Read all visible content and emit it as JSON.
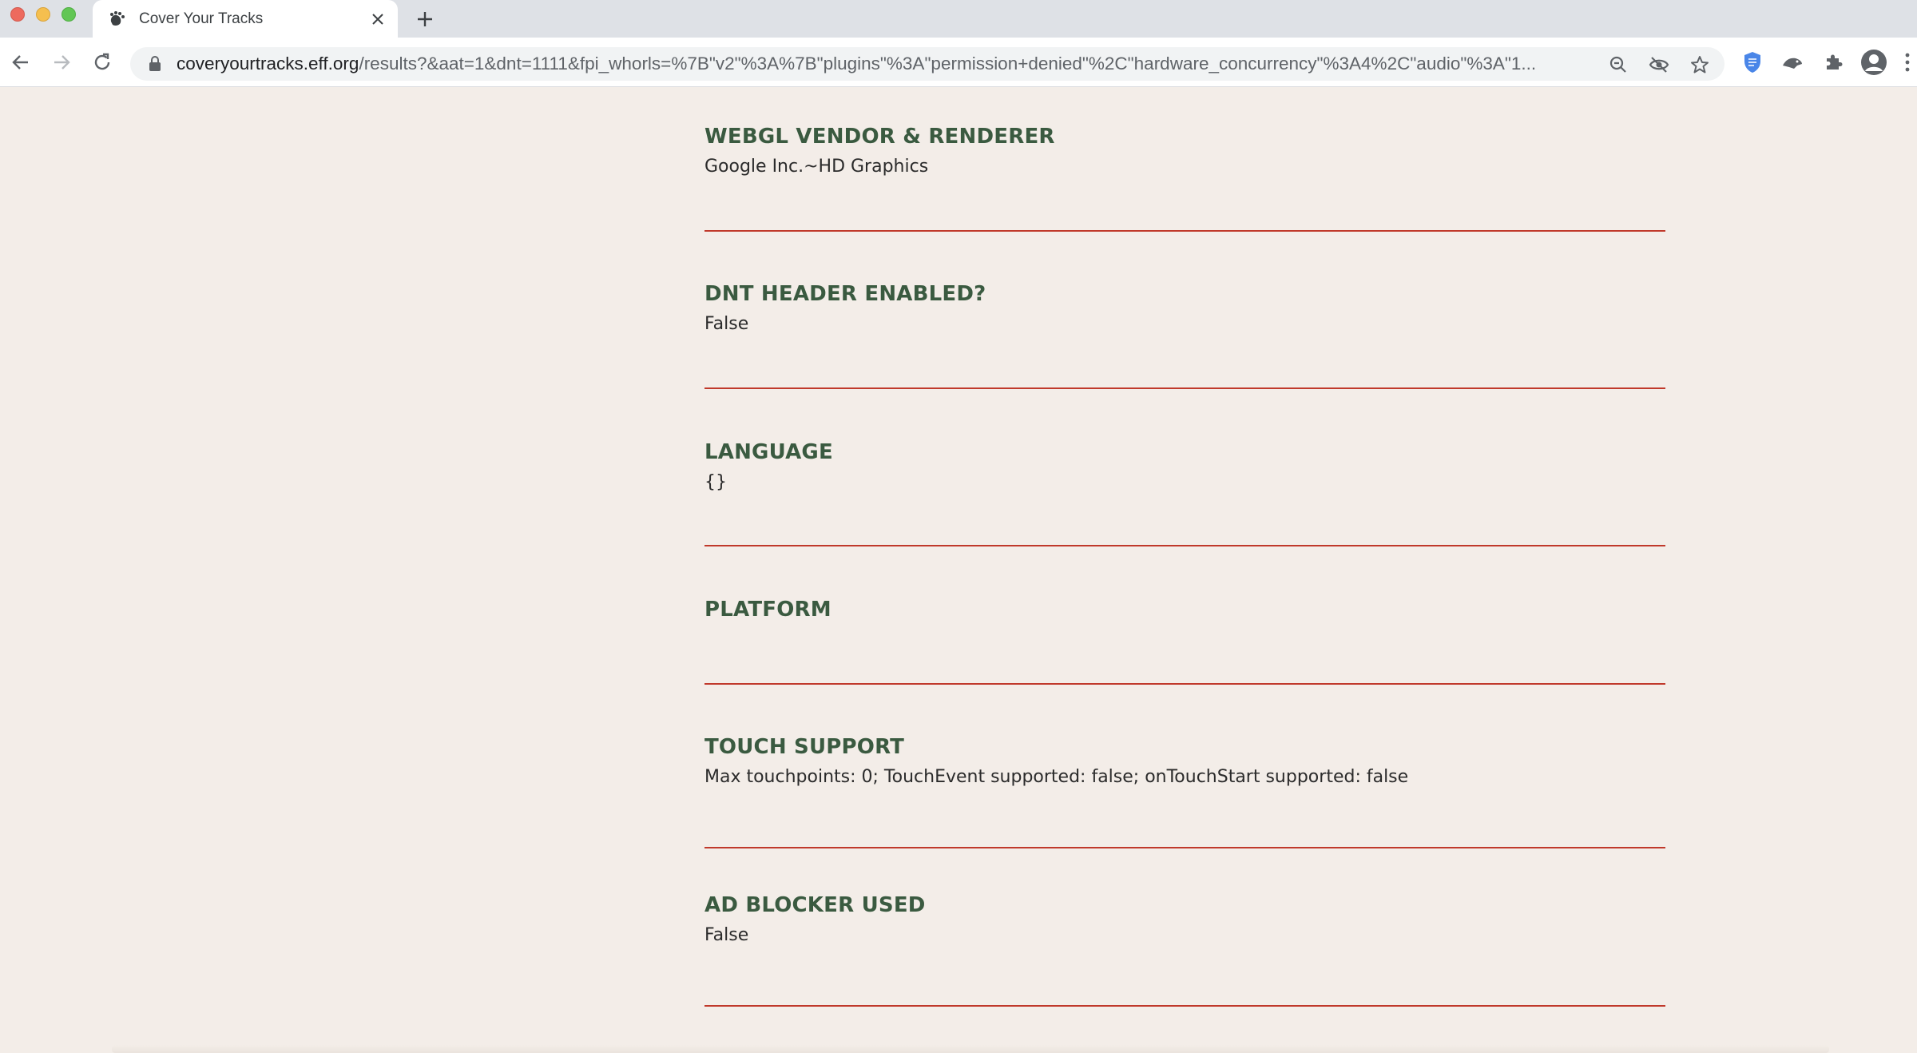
{
  "window": {
    "tab": {
      "title": "Cover Your Tracks",
      "favicon": "eff-footprint-icon"
    }
  },
  "toolbar": {
    "url_host": "coveryourtracks.eff.org",
    "url_path": "/results?&aat=1&dnt=1111&fpi_whorls=%7B\"v2\"%3A%7B\"plugins\"%3A\"permission+denied\"%2C\"hardware_concurrency\"%3A4%2C\"audio\"%3A\"1..."
  },
  "sections": [
    {
      "heading": "WEBGL VENDOR & RENDERER",
      "value": "Google Inc.~HD Graphics"
    },
    {
      "heading": "DNT HEADER ENABLED?",
      "value": "False"
    },
    {
      "heading": "LANGUAGE",
      "value": "{}"
    },
    {
      "heading": "PLATFORM",
      "value": ""
    },
    {
      "heading": "TOUCH SUPPORT",
      "value": "Max touchpoints: 0; TouchEvent supported: false; onTouchStart supported: false"
    },
    {
      "heading": "AD BLOCKER USED",
      "value": "False"
    }
  ],
  "colors": {
    "heading": "#3a5a40",
    "divider": "#c0392b",
    "background": "#f3ede8"
  }
}
